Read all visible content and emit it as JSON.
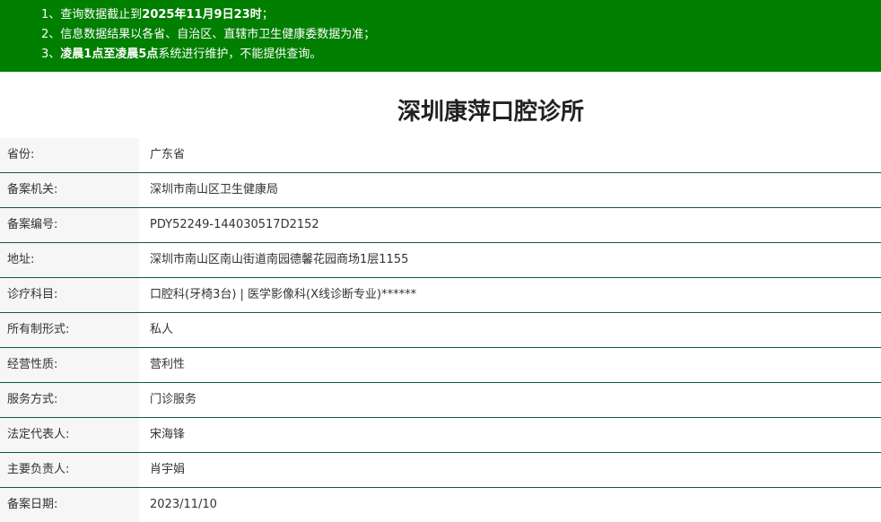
{
  "notice": {
    "lines": [
      {
        "prefix": "1、查询数据截止到",
        "bold": "2025年11月9日23时",
        "suffix": "；"
      },
      {
        "prefix": "2、信息数据结果以各省、自治区、直辖市卫生健康委数据为准；",
        "bold": "",
        "suffix": ""
      },
      {
        "prefix": "3、",
        "bold": "凌晨1点至凌晨5点",
        "suffix": "系统进行维护，不能提供查询。"
      }
    ]
  },
  "title": "深圳康萍口腔诊所",
  "rows": [
    {
      "label": "省份:",
      "value": "广东省"
    },
    {
      "label": "备案机关:",
      "value": "深圳市南山区卫生健康局"
    },
    {
      "label": "备案编号:",
      "value": "PDY52249-144030517D2152"
    },
    {
      "label": "地址:",
      "value": "深圳市南山区南山街道南园德馨花园商场1层1155"
    },
    {
      "label": "诊疗科目:",
      "value": "口腔科(牙椅3台) | 医学影像科(X线诊断专业)******"
    },
    {
      "label": "所有制形式:",
      "value": "私人"
    },
    {
      "label": "经营性质:",
      "value": "营利性"
    },
    {
      "label": "服务方式:",
      "value": "门诊服务"
    },
    {
      "label": "法定代表人:",
      "value": "宋海锋"
    },
    {
      "label": "主要负责人:",
      "value": "肖宇娟"
    },
    {
      "label": "备案日期:",
      "value": "2023/11/10"
    }
  ]
}
